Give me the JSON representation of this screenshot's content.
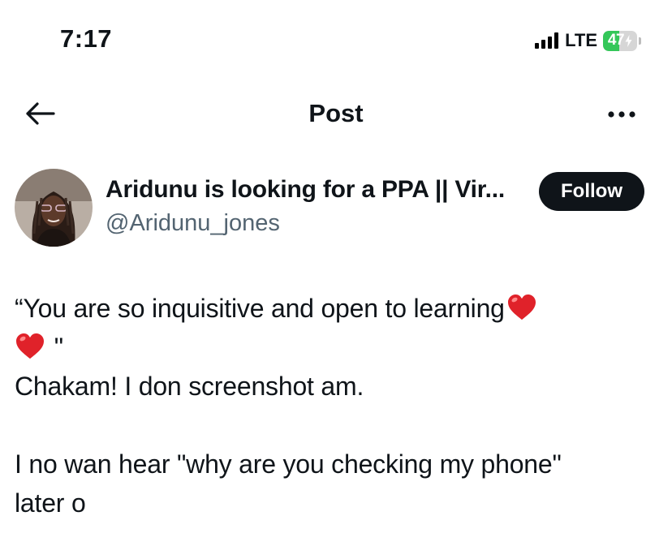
{
  "status_bar": {
    "time": "7:17",
    "network": "LTE",
    "battery_level": "47",
    "battery_percent": 47,
    "signal_icon": "cellular-signal-icon",
    "battery_icon": "battery-charging-icon"
  },
  "header": {
    "title": "Post",
    "back_icon": "arrow-left-icon",
    "more_icon": "ellipsis-icon"
  },
  "author": {
    "display_name": "Aridunu is looking for a PPA || Vir...",
    "handle": "@Aridunu_jones",
    "follow_label": "Follow"
  },
  "post": {
    "line1_text": "“You are so inquisitive and open to learning",
    "line2_text": " \"",
    "line3_text": "Chakam! I don screenshot am.",
    "line4_text": "I no wan hear \"why are you checking my phone\"",
    "line5_text": "later o",
    "emoji": "red-heart-icon"
  },
  "colors": {
    "text": "#0f1419",
    "secondary": "#536471",
    "follow_bg": "#0f1419",
    "battery_green": "#34c759",
    "heart_red": "#e0222a"
  }
}
